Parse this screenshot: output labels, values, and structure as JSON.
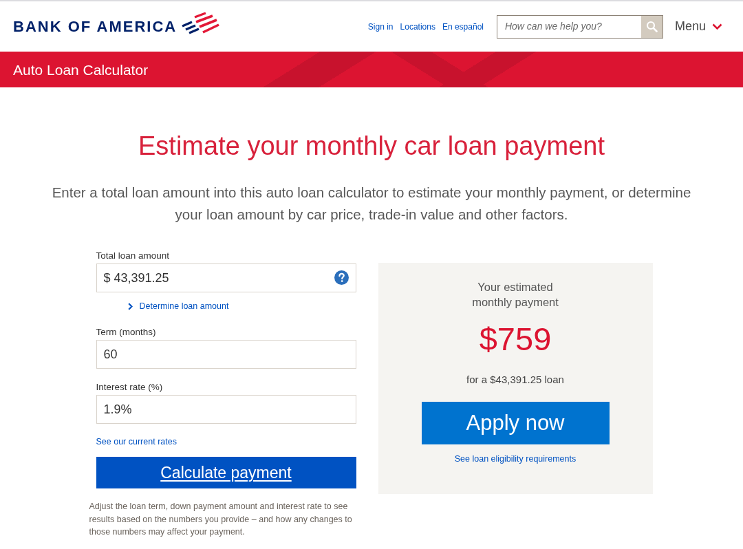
{
  "header": {
    "logo": "BANK OF AMERICA",
    "links": [
      "Sign in",
      "Locations",
      "En español"
    ],
    "search": {
      "placeholder": "How can we help you?"
    },
    "menu": "Menu"
  },
  "banner": {
    "title": "Auto Loan Calculator"
  },
  "heading": "Estimate your monthly car loan payment",
  "intro": "Enter a total loan amount into this auto loan calculator to estimate your monthly payment, or determine your loan amount by car price, trade-in value and other factors.",
  "calculator": {
    "fields": [
      {
        "kind": "amount",
        "label": "Total loan amount",
        "value": "$ 43,391.25",
        "link": "Determine loan amount"
      },
      {
        "kind": "plain",
        "label": "Term (months)",
        "value": "60"
      },
      {
        "kind": "plain",
        "label": "Interest rate (%)",
        "value": "1.9%"
      }
    ],
    "rates_link": "See our current rates",
    "calculate_button": "Calculate payment",
    "note": "Adjust the loan term, down payment amount and interest rate to see results based on the numbers you provide – and how any changes to those numbers may affect your payment."
  },
  "result": {
    "title": "Your estimated monthly payment",
    "amount": "$759",
    "caption": "for a $43,391.25 loan",
    "apply_button": "Apply now",
    "eligibility_link": "See loan eligibility requirements"
  }
}
